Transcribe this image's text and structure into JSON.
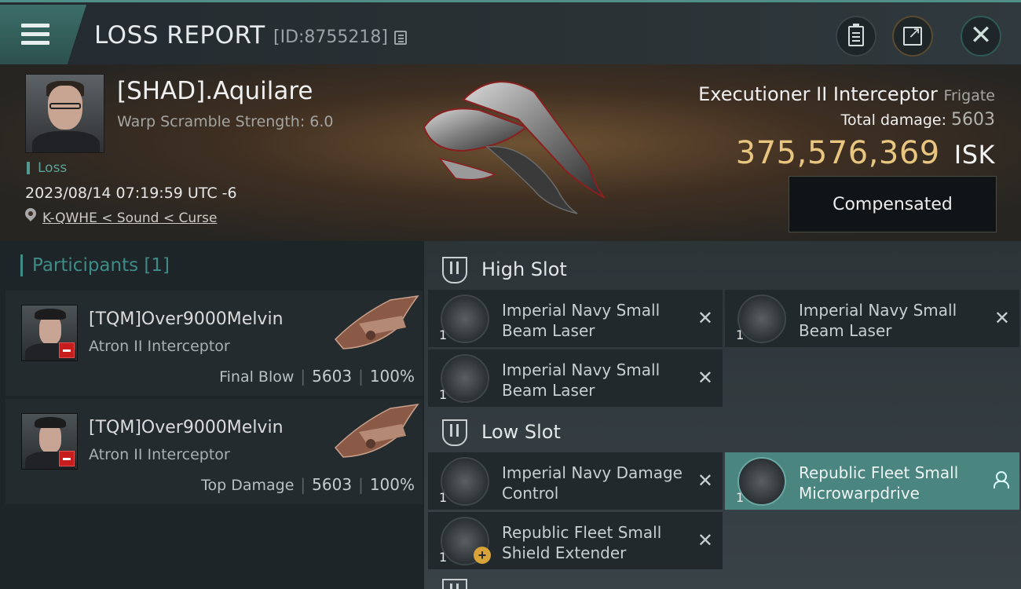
{
  "header": {
    "title": "LOSS REPORT",
    "report_id": "[ID:8755218]"
  },
  "victim": {
    "name": "[SHAD].Aquilare",
    "warp_scramble": "Warp Scramble Strength: 6.0",
    "status": "Loss",
    "datetime": "2023/08/14 07:19:59 UTC -6",
    "location": "K-QWHE < Sound < Curse",
    "ship_name": "Executioner II Interceptor",
    "ship_class": "Frigate",
    "total_damage_label": "Total damage:",
    "total_damage": "5603",
    "isk_value": "375,576,369",
    "isk_unit": "ISK",
    "compensation_label": "Compensated"
  },
  "participants": {
    "label": "Participants [1]",
    "items": [
      {
        "name": "[TQM]Over9000Melvin",
        "ship": "Atron II Interceptor",
        "role": "Final Blow",
        "damage": "5603",
        "percent": "100%"
      },
      {
        "name": "[TQM]Over9000Melvin",
        "ship": "Atron II Interceptor",
        "role": "Top Damage",
        "damage": "5603",
        "percent": "100%"
      }
    ]
  },
  "fitting": {
    "high_slot_label": "High Slot",
    "low_slot_label": "Low Slot",
    "high": [
      {
        "name": "Imperial Navy Small Beam Laser",
        "qty": "1",
        "icon": "beam-laser-icon"
      },
      {
        "name": "Imperial Navy Small Beam Laser",
        "qty": "1",
        "icon": "beam-laser-icon"
      },
      {
        "name": "Imperial Navy Small Beam Laser",
        "qty": "1",
        "icon": "beam-laser-icon"
      }
    ],
    "low": [
      {
        "name": "Imperial Navy Damage Control",
        "qty": "1",
        "icon": "damage-control-icon"
      },
      {
        "name": "Republic Fleet Small Microwarpdrive",
        "qty": "1",
        "icon": "microwarpdrive-icon",
        "state": "dropped"
      },
      {
        "name": "Republic Fleet Small Shield Extender",
        "qty": "1",
        "icon": "shield-extender-icon"
      }
    ]
  },
  "colors": {
    "accent": "#4f9b92",
    "isk": "#e9c680",
    "active_module": "#4a8580",
    "badge_red": "#c81d1d"
  }
}
